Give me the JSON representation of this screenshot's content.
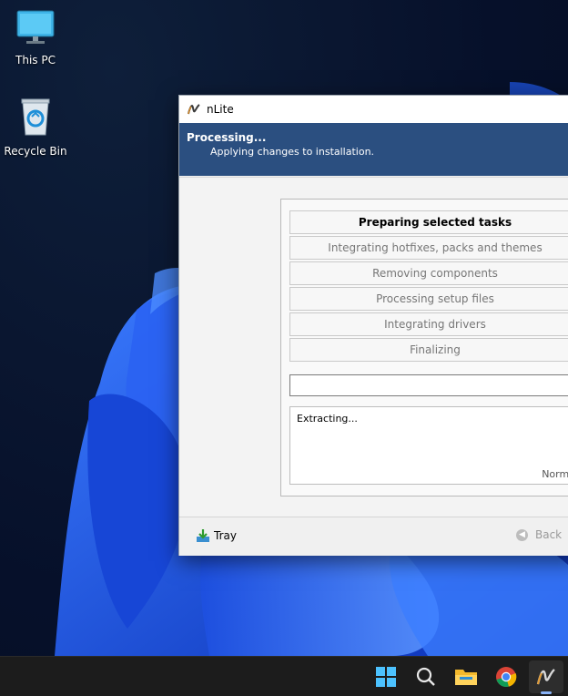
{
  "desktop": {
    "icons": [
      {
        "label": "This PC",
        "icon": "monitor-icon"
      },
      {
        "label": "Recycle Bin",
        "icon": "recycle-bin-icon"
      }
    ]
  },
  "window": {
    "title": "nLite",
    "header_title": "Processing...",
    "header_subtitle": "Applying changes to installation.",
    "tasks": [
      {
        "label": "Preparing selected tasks",
        "active": true
      },
      {
        "label": "Integrating hotfixes, packs and themes",
        "active": false
      },
      {
        "label": "Removing components",
        "active": false
      },
      {
        "label": "Processing setup files",
        "active": false
      },
      {
        "label": "Integrating drivers",
        "active": false
      },
      {
        "label": "Finalizing",
        "active": false
      }
    ],
    "progress_fraction": 0,
    "log_text": "Extracting...",
    "priority_label": "Normal",
    "tray_label": "Tray",
    "back_label": "Back"
  },
  "taskbar": {
    "icons": [
      "windows-start-icon",
      "search-icon",
      "file-explorer-icon",
      "chrome-icon",
      "nlite-icon"
    ],
    "active": "nlite-icon"
  },
  "colors": {
    "header_bg": "#2b4f80",
    "taskbar_bg": "#1c1c1c"
  }
}
